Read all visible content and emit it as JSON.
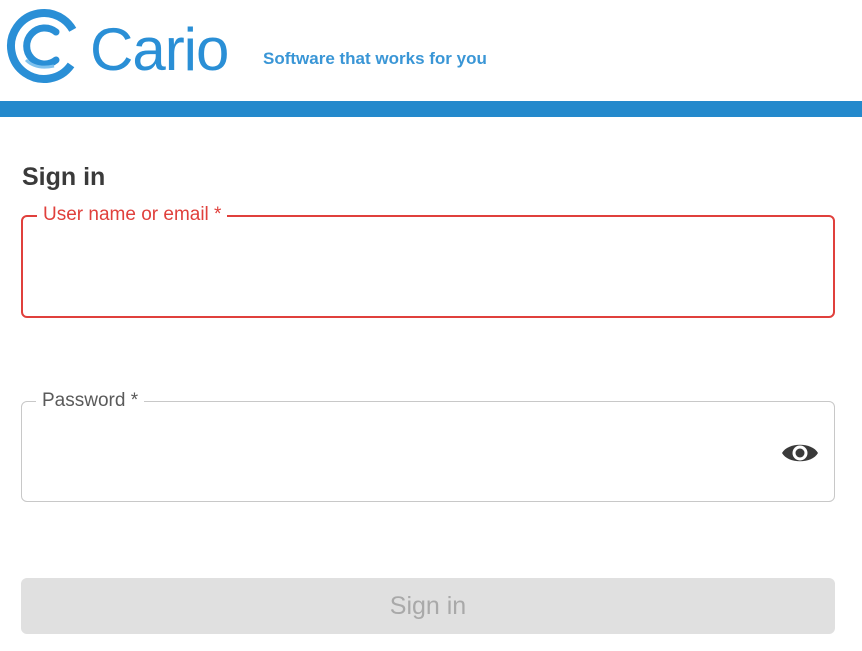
{
  "header": {
    "brand_name": "Cario",
    "tagline": "Software that works for you",
    "logo_icon": "cario-c-logo",
    "brand_color": "#2a8fd6",
    "bar_color": "#2489cc"
  },
  "form": {
    "heading": "Sign in",
    "username": {
      "label": "User name or email *",
      "value": "",
      "state": "error",
      "border_color": "#e0403c"
    },
    "password": {
      "label": "Password *",
      "value": "",
      "toggle_icon": "eye-icon"
    },
    "submit": {
      "label": "Sign in",
      "state": "disabled"
    }
  }
}
